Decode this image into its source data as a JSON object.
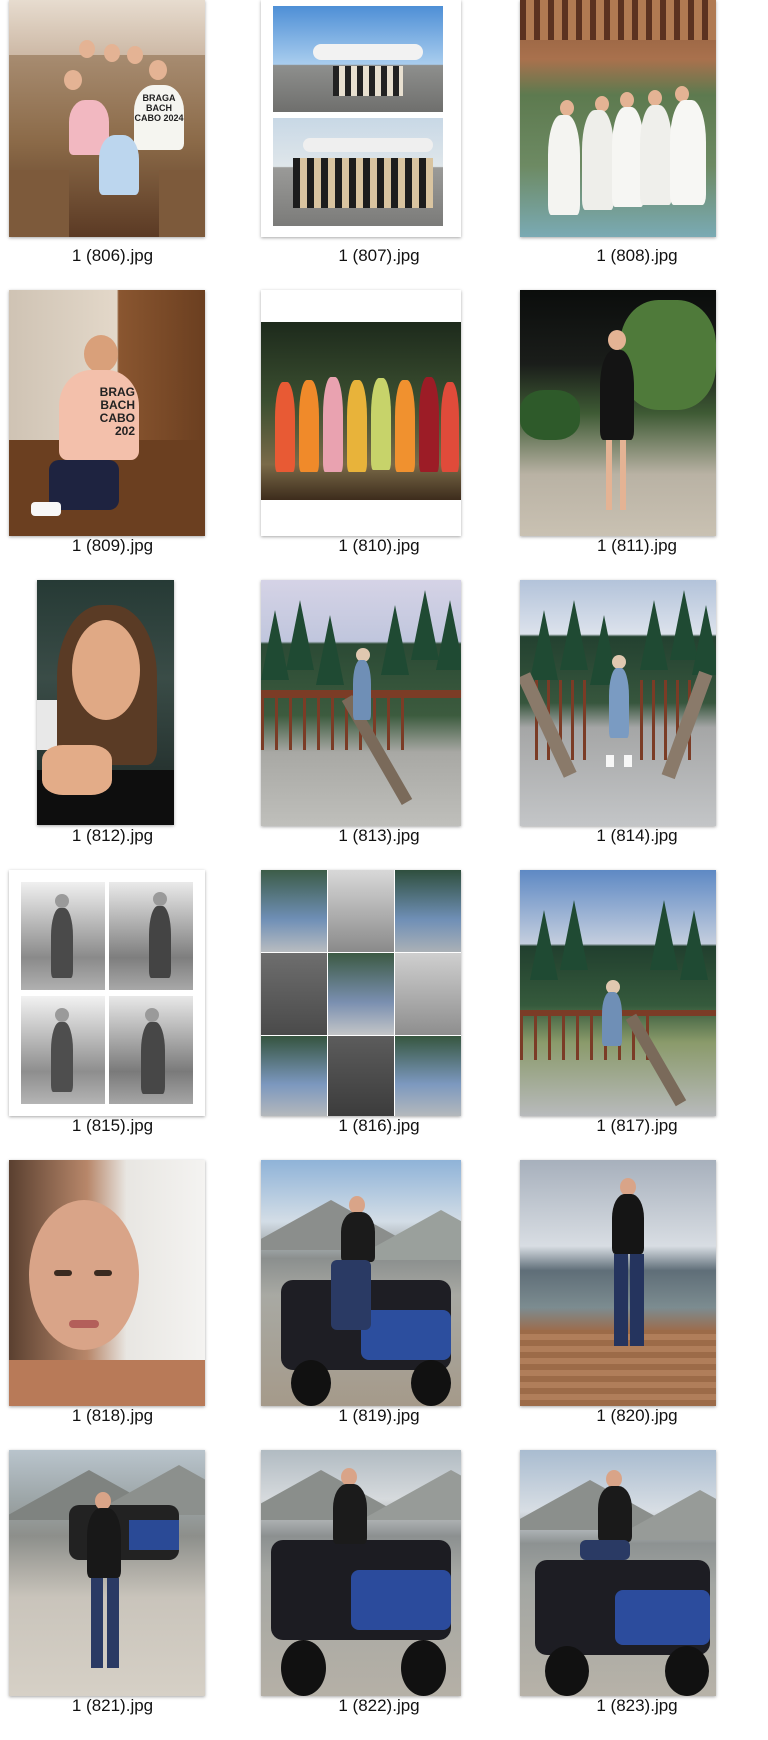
{
  "files": [
    {
      "name": "1 (806).jpg"
    },
    {
      "name": "1 (807).jpg"
    },
    {
      "name": "1 (808).jpg"
    },
    {
      "name": "1 (809).jpg"
    },
    {
      "name": "1 (810).jpg"
    },
    {
      "name": "1 (811).jpg"
    },
    {
      "name": "1 (812).jpg"
    },
    {
      "name": "1 (813).jpg"
    },
    {
      "name": "1 (814).jpg"
    },
    {
      "name": "1 (815).jpg"
    },
    {
      "name": "1 (816).jpg"
    },
    {
      "name": "1 (817).jpg"
    },
    {
      "name": "1 (818).jpg"
    },
    {
      "name": "1 (819).jpg"
    },
    {
      "name": "1 (820).jpg"
    },
    {
      "name": "1 (821).jpg"
    },
    {
      "name": "1 (822).jpg"
    },
    {
      "name": "1 (823).jpg"
    }
  ],
  "thumb_text": {
    "hoodie_806": "BRAGA BACH CABO 2024",
    "hoodie_809": "BRAG BACH CABO 202"
  }
}
